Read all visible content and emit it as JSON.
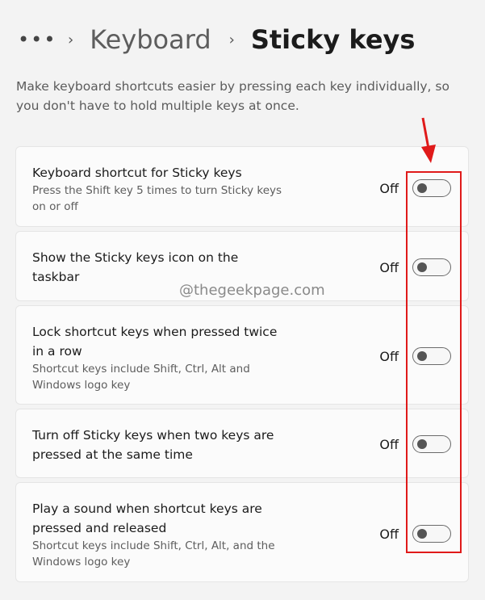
{
  "breadcrumb": {
    "more": "•••",
    "parent": "Keyboard",
    "current": "Sticky keys"
  },
  "description": "Make keyboard shortcuts easier by pressing each key individually, so you don't have to hold multiple keys at once.",
  "watermark": "@thegeekpage.com",
  "settings": [
    {
      "title": "Keyboard shortcut for Sticky keys",
      "subtitle": "Press the Shift key 5 times to turn Sticky keys on or off",
      "state": "Off"
    },
    {
      "title": "Show the Sticky keys icon on the taskbar",
      "subtitle": "",
      "state": "Off"
    },
    {
      "title": "Lock shortcut keys when pressed twice in a row",
      "subtitle": "Shortcut keys include Shift, Ctrl, Alt and Windows logo key",
      "state": "Off"
    },
    {
      "title": "Turn off Sticky keys when two keys are pressed at the same time",
      "subtitle": "",
      "state": "Off"
    },
    {
      "title": "Play a sound when shortcut keys are pressed and released",
      "subtitle": "Shortcut keys include Shift, Ctrl, Alt, and the Windows logo key",
      "state": "Off"
    }
  ],
  "colors": {
    "highlight": "#e01a1a",
    "background": "#f3f3f3",
    "card": "#fbfbfb"
  },
  "icons": {
    "more": "more-icon",
    "separator": "chevron-right-icon",
    "annotation": "red-arrow-icon"
  }
}
